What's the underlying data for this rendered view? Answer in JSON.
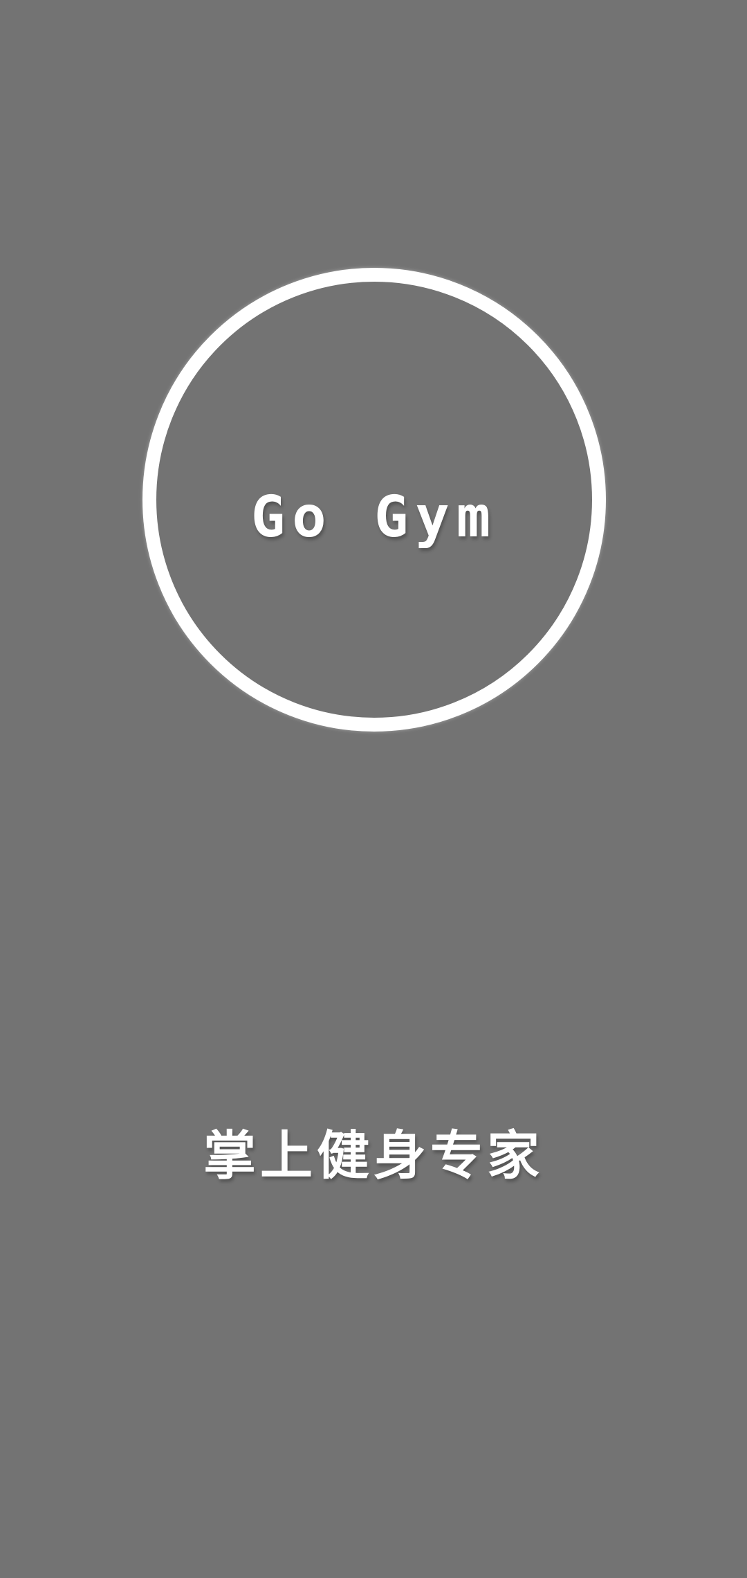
{
  "splash": {
    "logo_text": "Go Gym",
    "tagline": "掌上健身专家"
  },
  "colors": {
    "background": "#737373",
    "foreground": "#ffffff"
  }
}
